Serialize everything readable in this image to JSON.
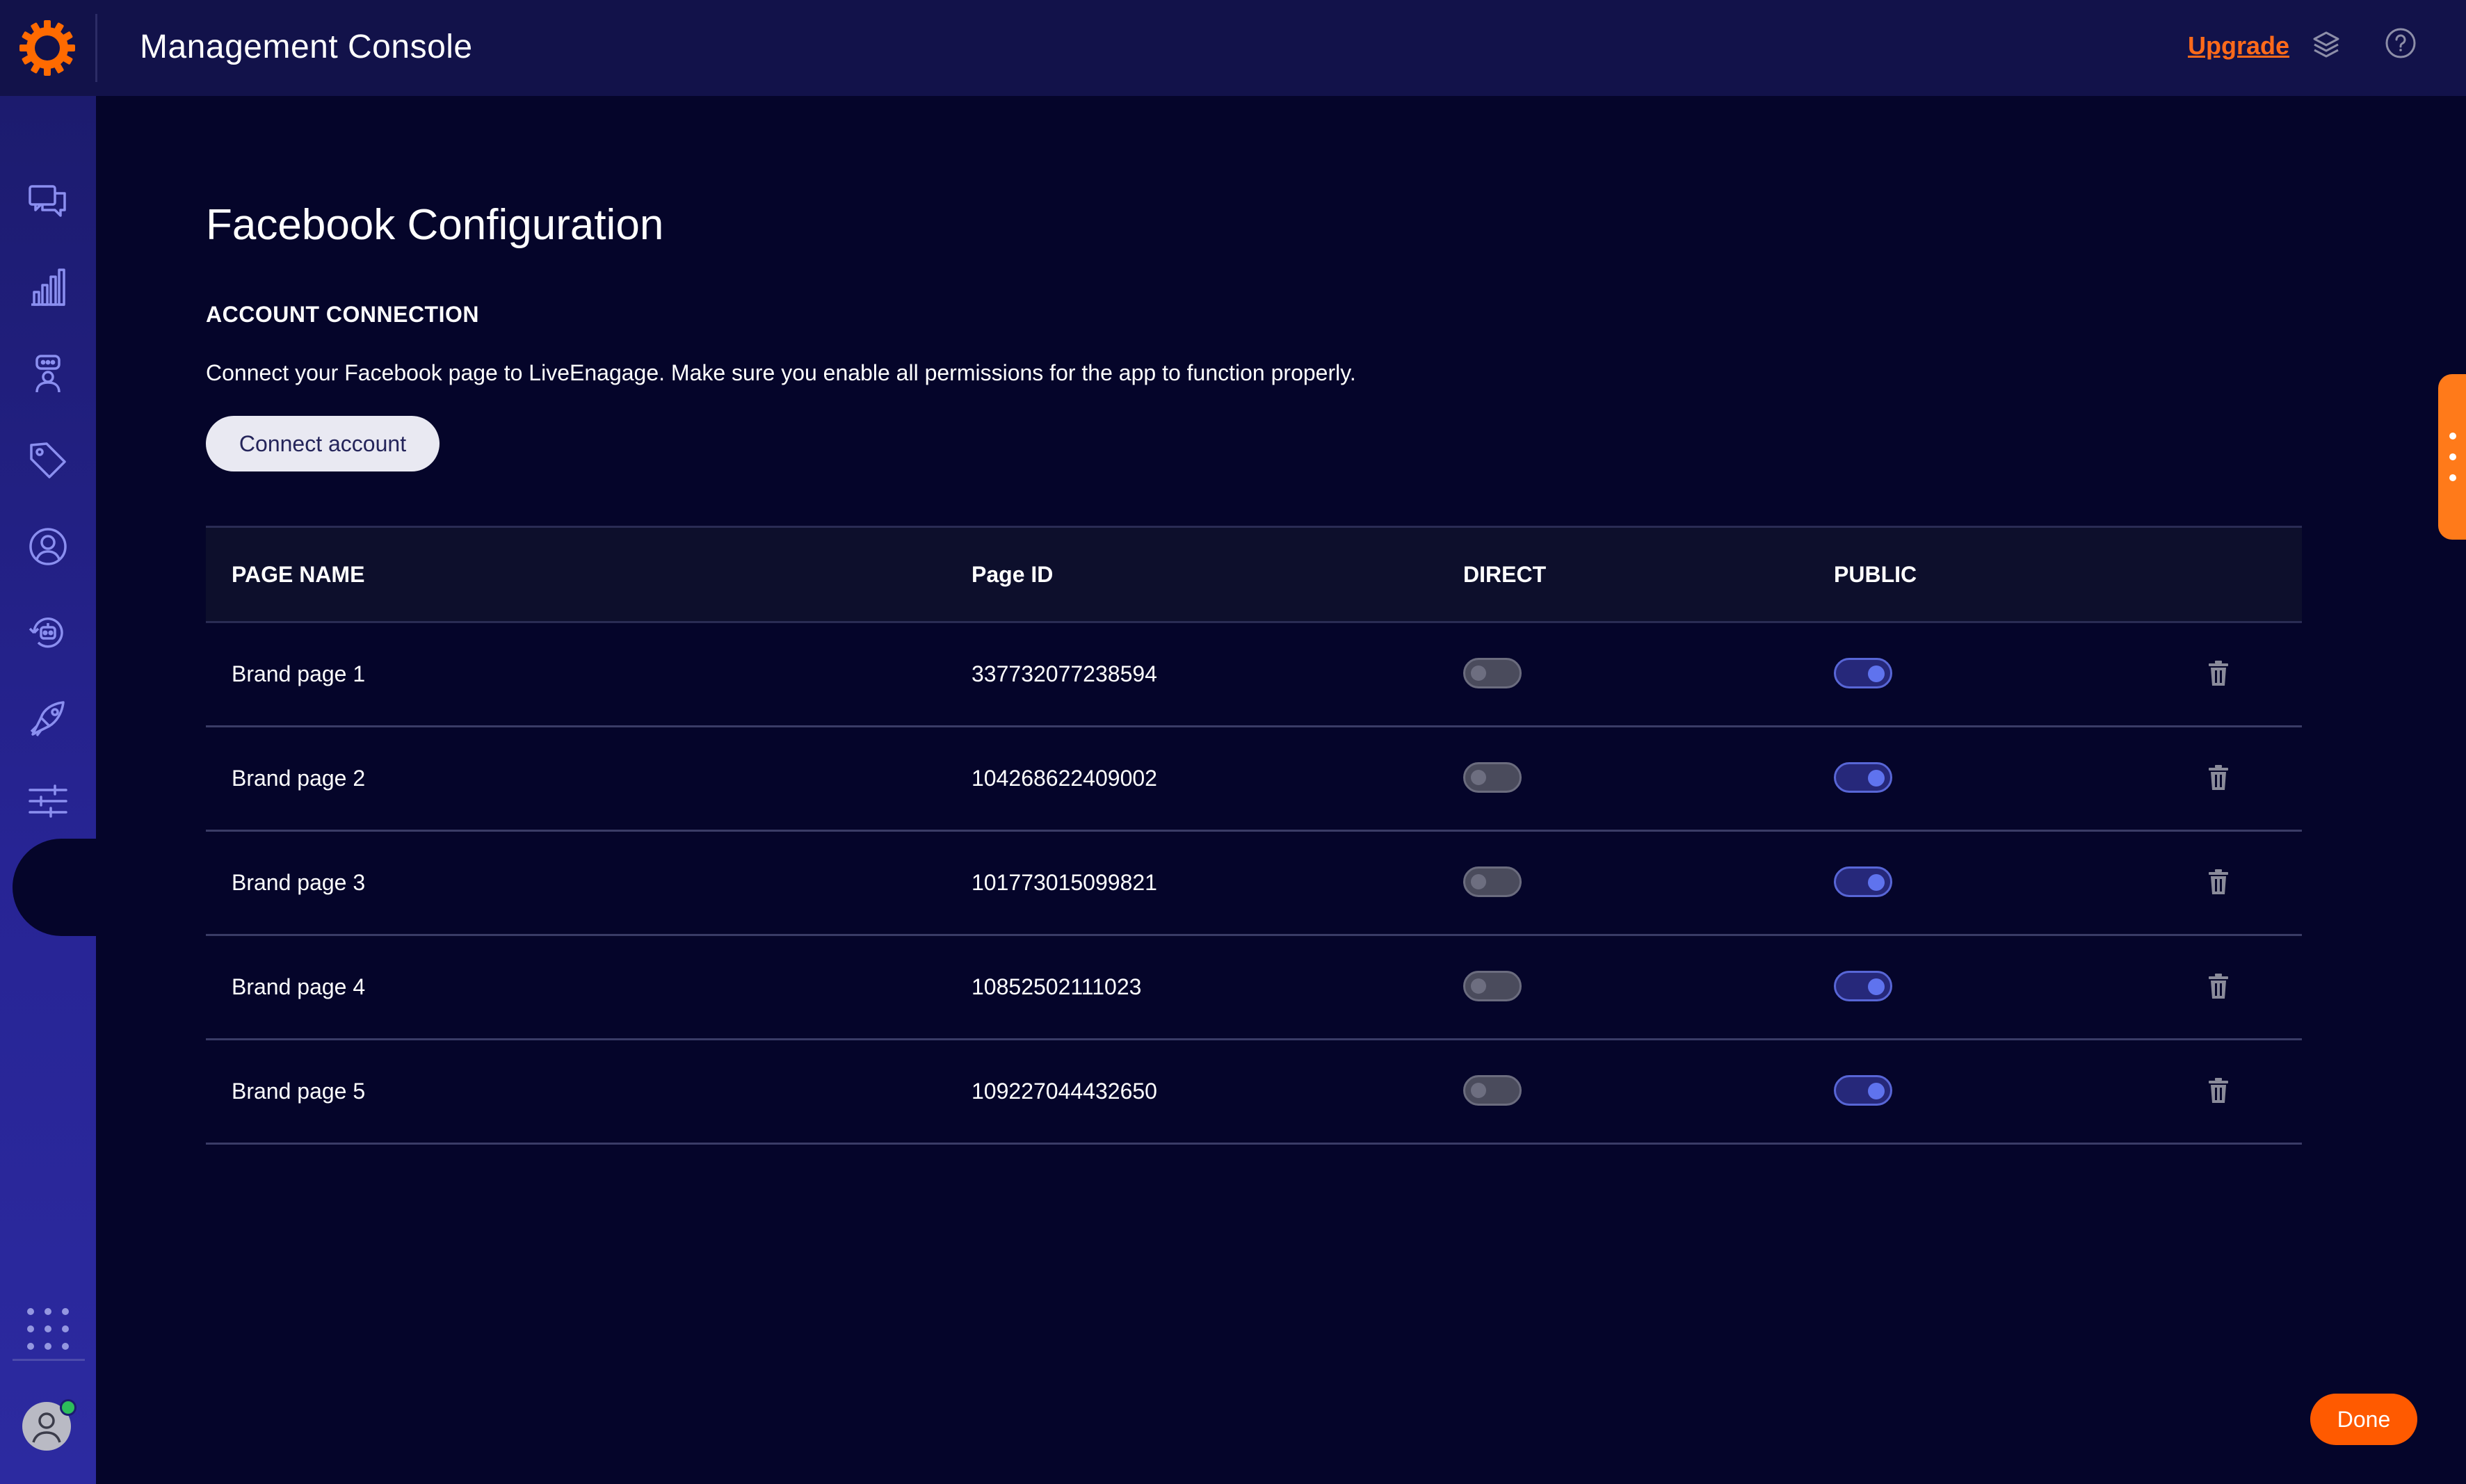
{
  "header": {
    "title": "Management Console",
    "upgrade_label": "Upgrade",
    "accent_color": "#ff6a1a"
  },
  "sidebar": {
    "items": [
      {
        "icon": "conversations-icon"
      },
      {
        "icon": "analytics-icon"
      },
      {
        "icon": "agent-icon"
      },
      {
        "icon": "tag-icon"
      },
      {
        "icon": "user-profile-icon"
      },
      {
        "icon": "bot-icon"
      },
      {
        "icon": "campaigns-icon"
      },
      {
        "icon": "settings-sliders-icon",
        "active": true
      }
    ],
    "bottom": [
      "apps-grid-icon",
      "avatar"
    ]
  },
  "page": {
    "title": "Facebook Configuration",
    "section_heading": "ACCOUNT CONNECTION",
    "section_description": "Connect your Facebook page to LiveEnagage. Make sure you enable all permissions for the app to function properly.",
    "connect_button": "Connect account"
  },
  "table": {
    "columns": [
      "PAGE NAME",
      "Page ID",
      "DIRECT",
      "PUBLIC"
    ],
    "rows": [
      {
        "name": "Brand page 1",
        "page_id": "337732077238594",
        "direct": false,
        "public": true
      },
      {
        "name": "Brand page 2",
        "page_id": "104268622409002",
        "direct": false,
        "public": true
      },
      {
        "name": "Brand page 3",
        "page_id": "101773015099821",
        "direct": false,
        "public": true
      },
      {
        "name": "Brand page 4",
        "page_id": "10852502111023",
        "direct": false,
        "public": true
      },
      {
        "name": "Brand page 5",
        "page_id": "109227044432650",
        "direct": false,
        "public": true
      }
    ]
  },
  "footer": {
    "done_label": "Done"
  },
  "colors": {
    "background": "#05052a",
    "topbar": "#12124a",
    "sidebar": "#272494",
    "done_button": "#ff5a00",
    "toggle_on": "#5f73ee"
  }
}
